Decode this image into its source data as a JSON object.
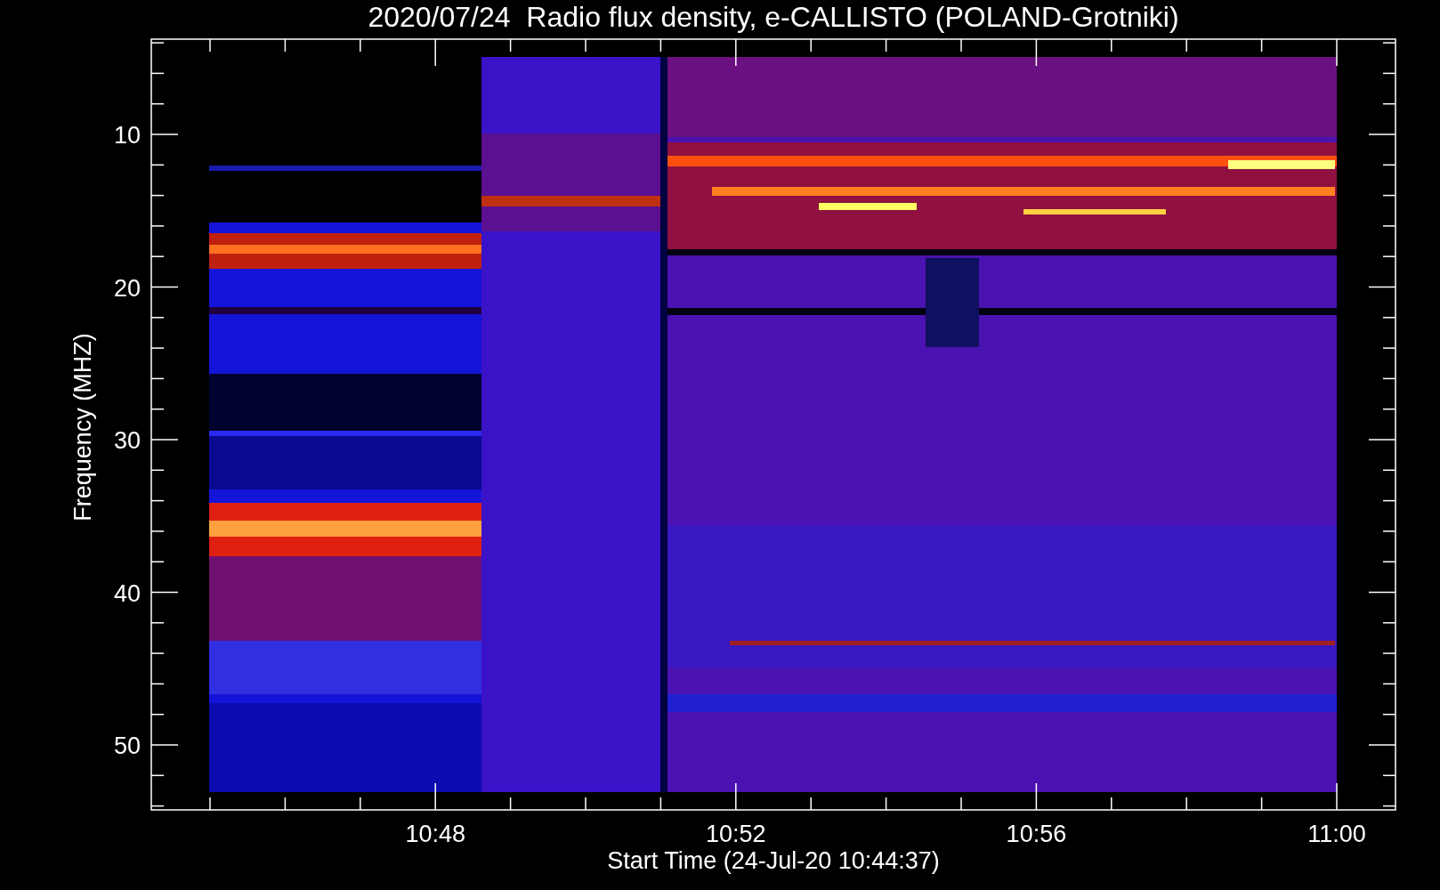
{
  "title": "2020/07/24  Radio flux density, e-CALLISTO (POLAND-Grotniki)",
  "y_axis": {
    "label": "Frequency (MHZ)",
    "ticks": [
      "10",
      "20",
      "30",
      "40",
      "50"
    ]
  },
  "x_axis": {
    "label": "Start Time (24-Jul-20 10:44:37)",
    "ticks": [
      "10:48",
      "10:52",
      "10:56",
      "11:00"
    ]
  }
}
